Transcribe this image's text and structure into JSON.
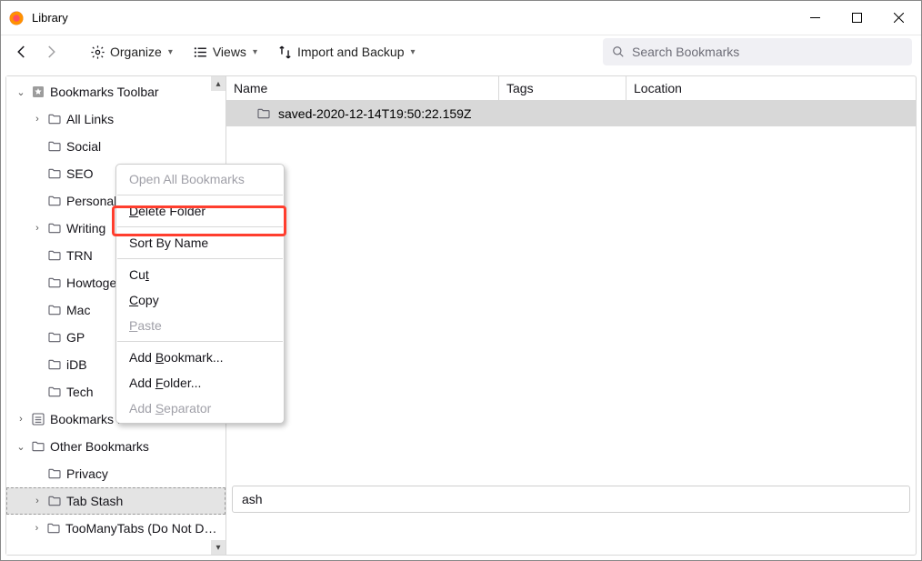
{
  "window": {
    "title": "Library"
  },
  "toolbar": {
    "organize": "Organize",
    "views": "Views",
    "import_backup": "Import and Backup"
  },
  "search": {
    "placeholder": "Search Bookmarks"
  },
  "sidebar": {
    "items": [
      {
        "label": "Bookmarks Toolbar",
        "level": 0,
        "icon": "star-box",
        "twisty": "down",
        "selected": false
      },
      {
        "label": "All Links",
        "level": 1,
        "icon": "folder",
        "twisty": "right",
        "selected": false
      },
      {
        "label": "Social",
        "level": 1,
        "icon": "folder",
        "twisty": "",
        "selected": false
      },
      {
        "label": "SEO",
        "level": 1,
        "icon": "folder",
        "twisty": "",
        "selected": false
      },
      {
        "label": "Personal",
        "level": 1,
        "icon": "folder",
        "twisty": "",
        "selected": false
      },
      {
        "label": "Writing",
        "level": 1,
        "icon": "folder",
        "twisty": "right",
        "selected": false
      },
      {
        "label": "TRN",
        "level": 1,
        "icon": "folder",
        "twisty": "",
        "selected": false
      },
      {
        "label": "Howtogeek",
        "level": 1,
        "icon": "folder",
        "twisty": "",
        "selected": false
      },
      {
        "label": "Mac",
        "level": 1,
        "icon": "folder",
        "twisty": "",
        "selected": false
      },
      {
        "label": "GP",
        "level": 1,
        "icon": "folder",
        "twisty": "",
        "selected": false
      },
      {
        "label": "iDB",
        "level": 1,
        "icon": "folder",
        "twisty": "",
        "selected": false
      },
      {
        "label": "Tech",
        "level": 1,
        "icon": "folder",
        "twisty": "",
        "selected": false
      },
      {
        "label": "Bookmarks Menu",
        "level": 0,
        "icon": "menu-box",
        "twisty": "right",
        "selected": false
      },
      {
        "label": "Other Bookmarks",
        "level": 0,
        "icon": "folder",
        "twisty": "down",
        "selected": false
      },
      {
        "label": "Privacy",
        "level": 1,
        "icon": "folder",
        "twisty": "",
        "selected": false
      },
      {
        "label": "Tab Stash",
        "level": 1,
        "icon": "folder",
        "twisty": "right",
        "selected": true
      },
      {
        "label": "TooManyTabs (Do Not Delete)",
        "level": 1,
        "icon": "folder",
        "twisty": "right",
        "selected": false
      }
    ]
  },
  "columns": {
    "name": "Name",
    "tags": "Tags",
    "location": "Location"
  },
  "list": {
    "items": [
      {
        "name": "saved-2020-12-14T19:50:22.159Z",
        "icon": "folder"
      }
    ]
  },
  "detail": {
    "name": "ash"
  },
  "context_menu": {
    "open_all": "Open All Bookmarks",
    "delete_folder": "Delete Folder",
    "sort_by_name": "Sort By Name",
    "cut": "Cut",
    "copy": "Copy",
    "paste": "Paste",
    "add_bookmark": "Add Bookmark...",
    "add_folder": "Add Folder...",
    "add_separator": "Add Separator"
  }
}
